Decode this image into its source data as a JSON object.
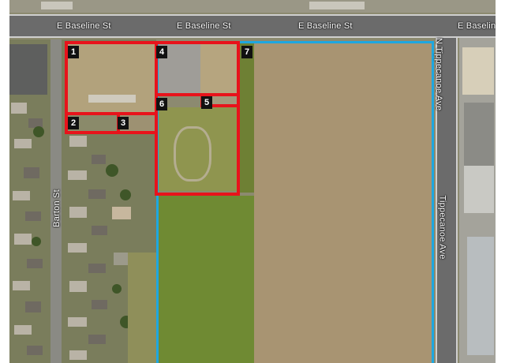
{
  "streets": {
    "north": "E Baseline St",
    "east_upper": "N Tippecanoe Ave",
    "east_lower": "Tippecanoe Ave",
    "west": "Barton St"
  },
  "parcels": [
    {
      "id": "parcel-1",
      "label": "1"
    },
    {
      "id": "parcel-2",
      "label": "2"
    },
    {
      "id": "parcel-3",
      "label": "3"
    },
    {
      "id": "parcel-4",
      "label": "4"
    },
    {
      "id": "parcel-5",
      "label": "5"
    },
    {
      "id": "parcel-6",
      "label": "6"
    },
    {
      "id": "parcel-7",
      "label": "7"
    }
  ],
  "colors": {
    "parcel_outline": "#e8131b",
    "site_boundary": "#1ea7e0",
    "tag_background": "#111111"
  }
}
